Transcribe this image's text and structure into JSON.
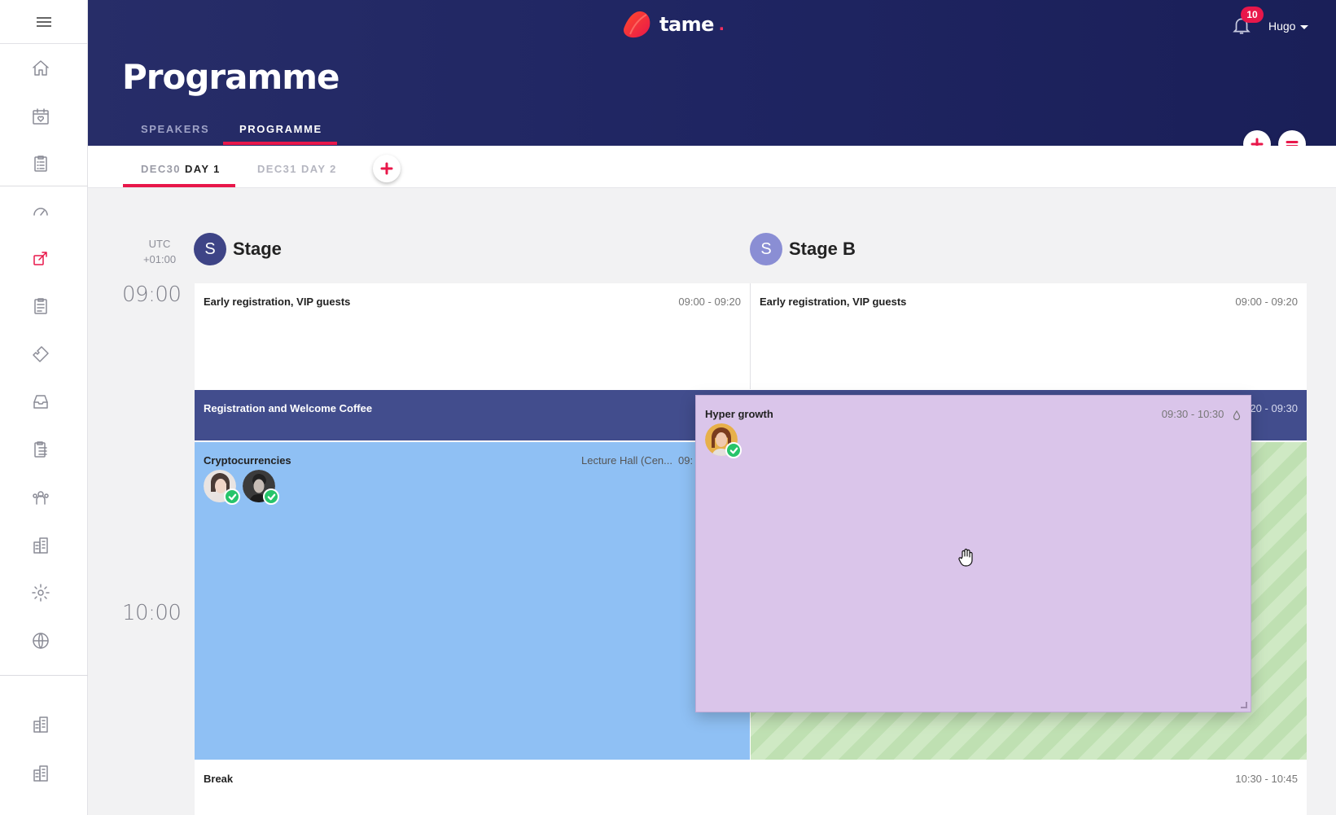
{
  "app": {
    "brand": "tame",
    "notifications_count": "10",
    "user_name": "Hugo",
    "page_title": "Programme"
  },
  "header_tabs": [
    {
      "label": "SPEAKERS",
      "active": false
    },
    {
      "label": "PROGRAMME",
      "active": true
    }
  ],
  "day_tabs": [
    {
      "date": "DEC30",
      "name": "DAY 1",
      "active": true
    },
    {
      "date": "DEC31",
      "name": "DAY 2",
      "active": false
    }
  ],
  "timezone": {
    "label": "UTC",
    "offset": "+01:00"
  },
  "times": [
    "09:00",
    "10:00"
  ],
  "stages": [
    {
      "initial": "S",
      "name": "Stage",
      "color": "#3e4486"
    },
    {
      "initial": "S",
      "name": "Stage B",
      "color": "#8a8ed4"
    }
  ],
  "sessions": {
    "early_a": {
      "title": "Early registration, VIP guests",
      "time": "09:00 - 09:20"
    },
    "early_b": {
      "title": "Early registration, VIP guests",
      "time": "09:00 - 09:20"
    },
    "welcome": {
      "title": "Registration and Welcome Coffee",
      "time_partial": "20 - 09:30"
    },
    "crypto": {
      "title": "Cryptocurrencies",
      "location": "Lecture Hall (Cen...",
      "time_partial": "09:"
    },
    "hyper": {
      "title": "Hyper growth",
      "time": "09:30 - 10:30"
    },
    "break": {
      "title": "Break",
      "time": "10:30 - 10:45"
    }
  },
  "colors": {
    "accent": "#e8174a",
    "header_bg": "#232964",
    "welcome_bg": "#424d8d",
    "crypto_bg": "#8fc0f4",
    "green_bg": "#bfe0b2",
    "drag_bg": "#dac5ea"
  },
  "icons": {
    "sidebar": [
      "home-icon",
      "calendar-heart-icon",
      "checklist-icon",
      "gauge-icon",
      "share-icon",
      "clipboard-list-icon",
      "ticket-icon",
      "inbox-icon",
      "clipboard-icon",
      "people-icon",
      "building-icon",
      "settings-icon",
      "globe-icon",
      "building-icon",
      "building-icon"
    ]
  }
}
